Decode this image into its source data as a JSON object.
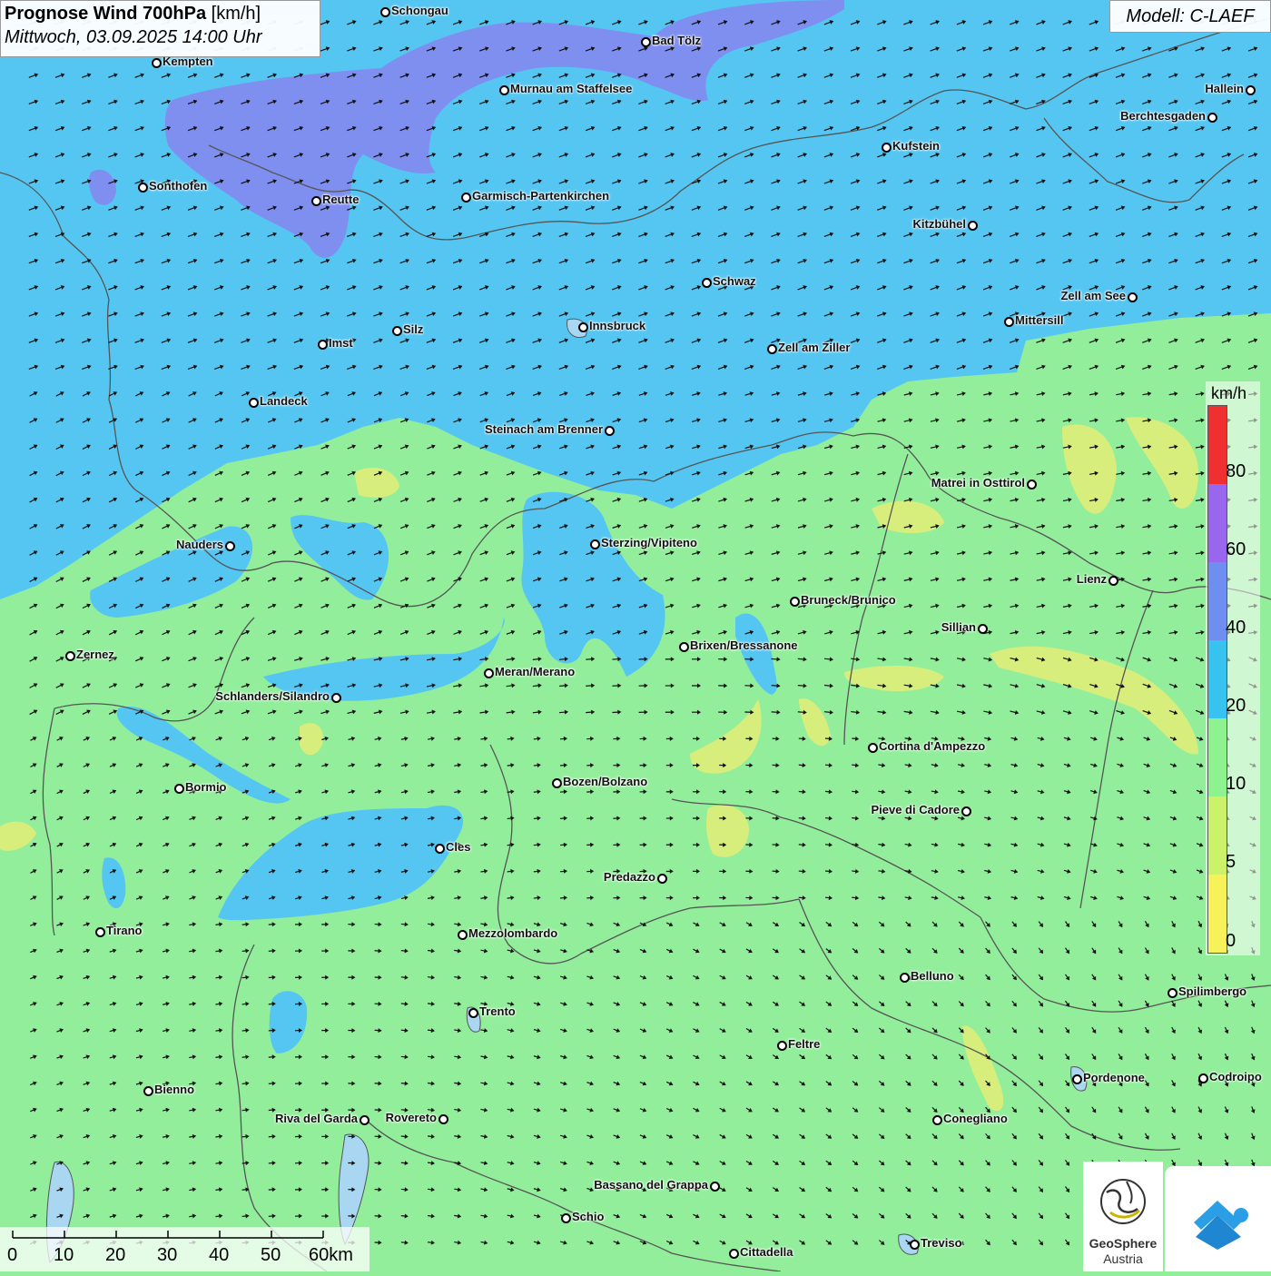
{
  "header": {
    "title_bold": "Prognose Wind 700hPa",
    "title_unit": "[km/h]",
    "datetime": "Mittwoch, 03.09.2025 14:00 Uhr",
    "model": "Modell: C-LAEF"
  },
  "legend": {
    "unit": "km/h",
    "ticks": [
      "80",
      "60",
      "40",
      "20",
      "10",
      "5",
      "0"
    ],
    "colors": [
      "#f03030",
      "#9966ee",
      "#6f8ff0",
      "#37c2f0",
      "#8ef28e",
      "#ccf26a",
      "#f7f25a"
    ]
  },
  "scale_bar": {
    "labels": [
      "0",
      "10",
      "20",
      "30",
      "40",
      "50",
      "60km"
    ]
  },
  "logos": {
    "geosphere_line1": "GeoSphere",
    "geosphere_line2": "Austria",
    "geosphere_icon": "geosphere-logo-icon",
    "app_icon": "wetter-app-logo-icon"
  },
  "colors": {
    "purple_zone": "#7f8ff0",
    "blue_zone": "#55c6f2",
    "green_zone": "#92ee9b",
    "yellow_zone": "#d8ee7c",
    "border": "#555555",
    "wind_arrow": "#111111"
  },
  "cities": [
    {
      "name": "Schongau",
      "label_side": "right"
    },
    {
      "name": "Bad Tölz",
      "label_side": "right"
    },
    {
      "name": "Kempten",
      "label_side": "right"
    },
    {
      "name": "Murnau am Staffelsee",
      "label_side": "right"
    },
    {
      "name": "Hallein",
      "label_side": "left"
    },
    {
      "name": "Berchtesgaden",
      "label_side": "left"
    },
    {
      "name": "Kufstein",
      "label_side": "right"
    },
    {
      "name": "Sonthofen",
      "label_side": "right"
    },
    {
      "name": "Reutte",
      "label_side": "right"
    },
    {
      "name": "Garmisch-Partenkirchen",
      "label_side": "right"
    },
    {
      "name": "Kitzbühel",
      "label_side": "left"
    },
    {
      "name": "Schwaz",
      "label_side": "right"
    },
    {
      "name": "Zell am See",
      "label_side": "left"
    },
    {
      "name": "Mittersill",
      "label_side": "right"
    },
    {
      "name": "Innsbruck",
      "label_side": "right"
    },
    {
      "name": "Zell am Ziller",
      "label_side": "right"
    },
    {
      "name": "Imst",
      "label_side": "right"
    },
    {
      "name": "Silz",
      "label_side": "right"
    },
    {
      "name": "Landeck",
      "label_side": "right"
    },
    {
      "name": "Steinach am Brenner",
      "label_side": "left"
    },
    {
      "name": "Matrei in Osttirol",
      "label_side": "left"
    },
    {
      "name": "Nauders",
      "label_side": "left"
    },
    {
      "name": "Sterzing/Vipiteno",
      "label_side": "right"
    },
    {
      "name": "Lienz",
      "label_side": "left"
    },
    {
      "name": "Bruneck/Brunico",
      "label_side": "right"
    },
    {
      "name": "Sillian",
      "label_side": "left"
    },
    {
      "name": "Zernez",
      "label_side": "right"
    },
    {
      "name": "Brixen/Bressanone",
      "label_side": "right"
    },
    {
      "name": "Meran/Merano",
      "label_side": "right"
    },
    {
      "name": "Schlanders/Silandro",
      "label_side": "left"
    },
    {
      "name": "Cortina d'Ampezzo",
      "label_side": "right"
    },
    {
      "name": "Bozen/Bolzano",
      "label_side": "right"
    },
    {
      "name": "Bormio",
      "label_side": "right"
    },
    {
      "name": "Pieve di Cadore",
      "label_side": "left"
    },
    {
      "name": "Cles",
      "label_side": "right"
    },
    {
      "name": "Predazzo",
      "label_side": "left"
    },
    {
      "name": "Tirano",
      "label_side": "right"
    },
    {
      "name": "Mezzolombardo",
      "label_side": "right"
    },
    {
      "name": "Belluno",
      "label_side": "right"
    },
    {
      "name": "Spilimbergo",
      "label_side": "right"
    },
    {
      "name": "Trento",
      "label_side": "right"
    },
    {
      "name": "Feltre",
      "label_side": "right"
    },
    {
      "name": "Pordenone",
      "label_side": "right"
    },
    {
      "name": "Codroipo",
      "label_side": "right"
    },
    {
      "name": "Bienno",
      "label_side": "right"
    },
    {
      "name": "Riva del Garda",
      "label_side": "left"
    },
    {
      "name": "Rovereto",
      "label_side": "left"
    },
    {
      "name": "Conegliano",
      "label_side": "right"
    },
    {
      "name": "Bassano del Grappa",
      "label_side": "left"
    },
    {
      "name": "Schio",
      "label_side": "right"
    },
    {
      "name": "Treviso",
      "label_side": "right"
    },
    {
      "name": "Cittadella",
      "label_side": "right"
    }
  ]
}
